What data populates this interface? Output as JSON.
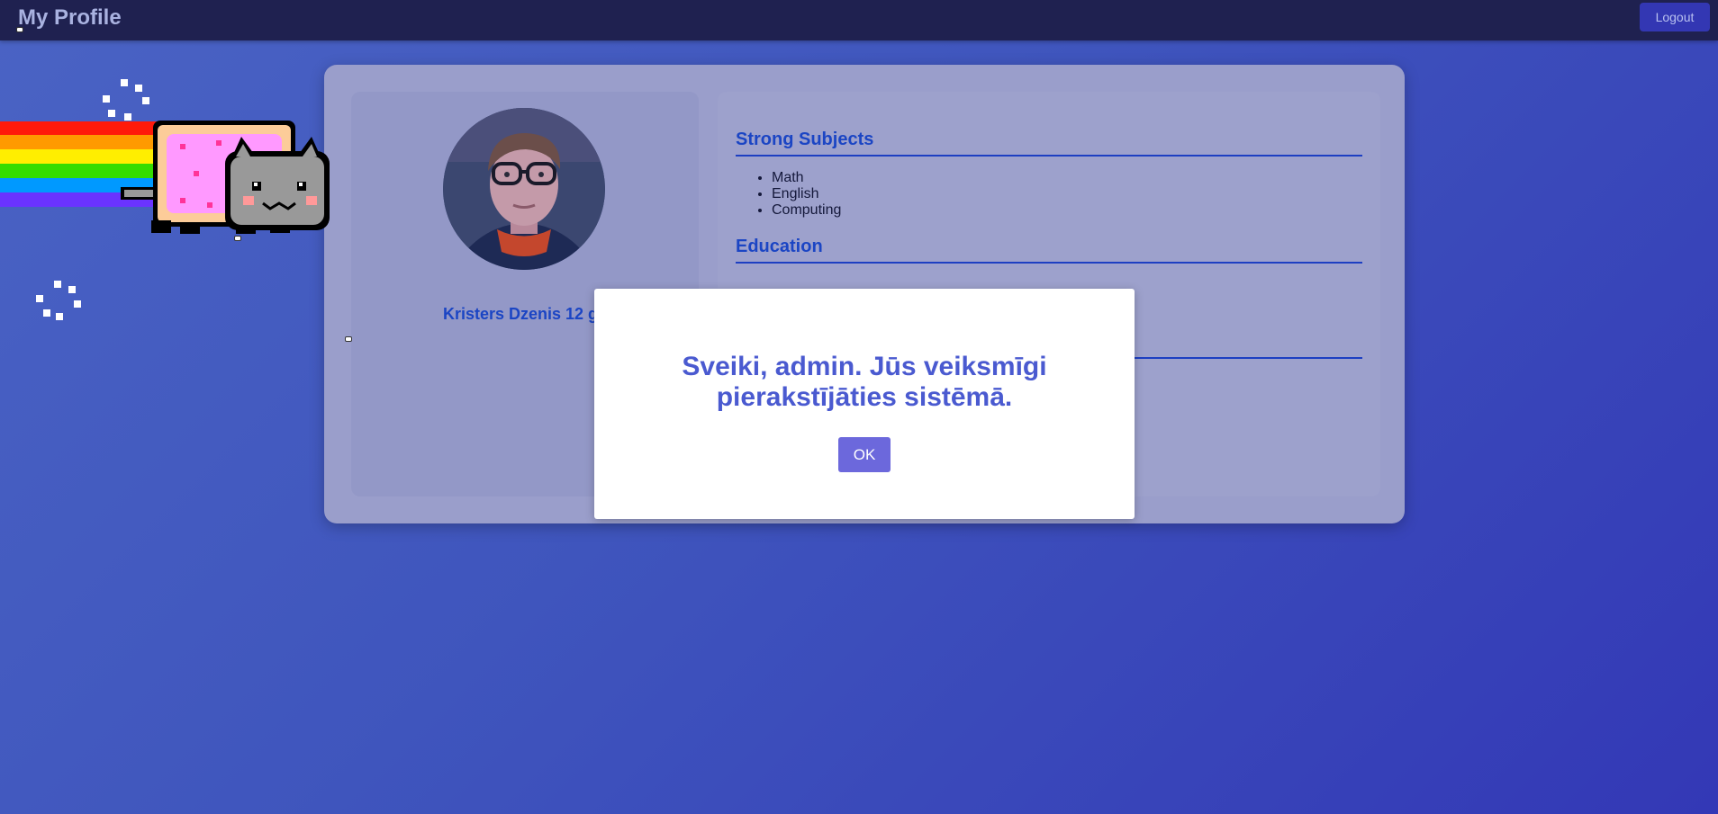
{
  "header": {
    "title": "My Profile",
    "logout_label": "Logout"
  },
  "profile": {
    "name": "Kristers Dzenis 12 ga"
  },
  "sections": {
    "strong_subjects": {
      "heading": "Strong Subjects",
      "items": [
        "Math",
        "English",
        "Computing"
      ]
    },
    "education": {
      "heading": "Education"
    }
  },
  "modal": {
    "message": "Sveiki, admin. Jūs veiksmīgi pierakstījāties sistēmā.",
    "ok_label": "OK"
  },
  "colors": {
    "accent": "#1b45c4",
    "modal_text": "#4a5ad0",
    "ok_button": "#6c68dc",
    "topbar": "#1f2150"
  }
}
